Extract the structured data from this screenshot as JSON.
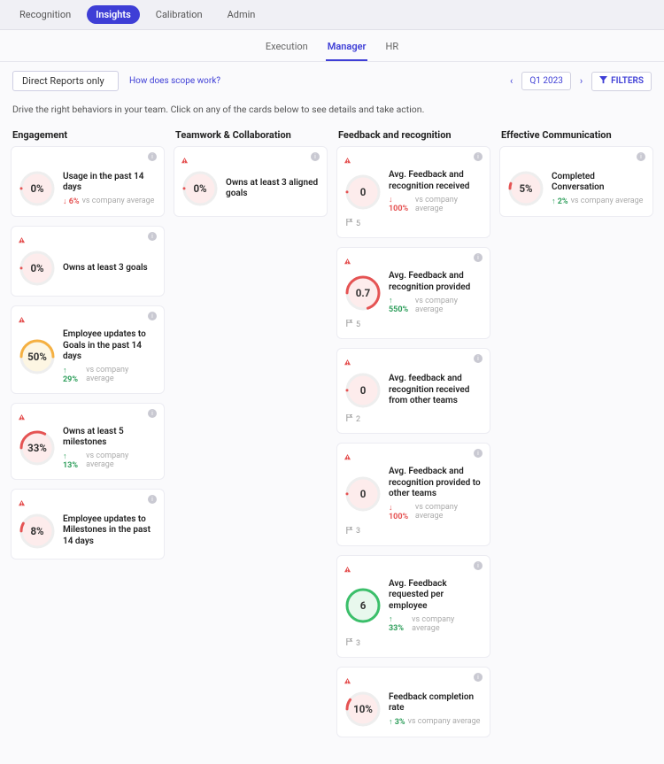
{
  "topnav": {
    "items": [
      {
        "label": "Recognition",
        "active": false
      },
      {
        "label": "Insights",
        "active": true
      },
      {
        "label": "Calibration",
        "active": false
      },
      {
        "label": "Admin",
        "active": false
      }
    ]
  },
  "subtabs": {
    "items": [
      {
        "label": "Execution",
        "active": false
      },
      {
        "label": "Manager",
        "active": true
      },
      {
        "label": "HR",
        "active": false
      }
    ]
  },
  "controls": {
    "scope": "Direct Reports only",
    "scope_help": "How does scope work?",
    "period": "Q1 2023",
    "filters_label": "FILTERS"
  },
  "intro": "Drive the right behaviors in your team. Click on any of the cards below to see details and take action.",
  "columns": [
    {
      "title": "Engagement",
      "cards": [
        {
          "value": "0%",
          "ring_pct": 0,
          "ring_color": "#e55353",
          "style": "pink",
          "title": "Usage in the past 14 days",
          "delta_dir": "down",
          "delta_val": "6%",
          "delta_vs": "vs company average",
          "warn": false
        },
        {
          "value": "0%",
          "ring_pct": 0,
          "ring_color": "#e55353",
          "style": "pink",
          "title": "Owns at least 3 goals",
          "delta_dir": null,
          "delta_val": "",
          "delta_vs": "",
          "warn": true
        },
        {
          "value": "50%",
          "ring_pct": 50,
          "ring_color": "#f5b041",
          "style": "yellow",
          "title": "Employee updates to Goals in the past 14 days",
          "delta_dir": "up",
          "delta_val": "29%",
          "delta_vs": "vs company average",
          "warn": true
        },
        {
          "value": "33%",
          "ring_pct": 33,
          "ring_color": "#e55353",
          "style": "pink",
          "title": "Owns at least 5 milestones",
          "delta_dir": "up",
          "delta_val": "13%",
          "delta_vs": "vs company average",
          "warn": true
        },
        {
          "value": "8%",
          "ring_pct": 8,
          "ring_color": "#e55353",
          "style": "pink",
          "title": "Employee updates to Milestones in the past 14 days",
          "delta_dir": null,
          "delta_val": "",
          "delta_vs": "",
          "warn": true
        }
      ]
    },
    {
      "title": "Teamwork & Collaboration",
      "cards": [
        {
          "value": "0%",
          "ring_pct": 0,
          "ring_color": "#e55353",
          "style": "pink",
          "title": "Owns at least 3 aligned goals",
          "delta_dir": null,
          "delta_val": "",
          "delta_vs": "",
          "warn": true
        }
      ]
    },
    {
      "title": "Feedback and recognition",
      "cards": [
        {
          "value": "0",
          "ring_pct": 0,
          "ring_color": "#e55353",
          "style": "pink",
          "title": "Avg. Feedback and recognition received",
          "delta_dir": "down",
          "delta_val": "100%",
          "delta_vs": "vs company average",
          "warn": true,
          "flag": "5"
        },
        {
          "value": "0.7",
          "ring_pct": 70,
          "ring_color": "#e55353",
          "style": "pink",
          "title": "Avg. Feedback and recognition provided",
          "delta_dir": "up",
          "delta_val": "550%",
          "delta_vs": "vs company average",
          "warn": true,
          "flag": "5"
        },
        {
          "value": "0",
          "ring_pct": 0,
          "ring_color": "#e55353",
          "style": "pink",
          "title": "Avg. feedback and recognition received from other teams",
          "delta_dir": null,
          "delta_val": "",
          "delta_vs": "",
          "warn": true,
          "flag": "2"
        },
        {
          "value": "0",
          "ring_pct": 0,
          "ring_color": "#e55353",
          "style": "pink",
          "title": "Avg. Feedback and recognition provided to other teams",
          "delta_dir": "down",
          "delta_val": "100%",
          "delta_vs": "vs company average",
          "warn": true,
          "flag": "3"
        },
        {
          "value": "6",
          "ring_pct": 100,
          "ring_color": "#3bbf6a",
          "style": "green",
          "title": "Avg. Feedback requested per employee",
          "delta_dir": "up",
          "delta_val": "33%",
          "delta_vs": "vs company average",
          "warn": true,
          "flag": "3"
        },
        {
          "value": "10%",
          "ring_pct": 10,
          "ring_color": "#e55353",
          "style": "pink",
          "title": "Feedback completion rate",
          "delta_dir": "up",
          "delta_val": "3%",
          "delta_vs": "vs company average",
          "warn": true
        }
      ]
    },
    {
      "title": "Effective Communication",
      "cards": [
        {
          "value": "5%",
          "ring_pct": 5,
          "ring_color": "#e55353",
          "style": "pink",
          "title": "Completed Conversation",
          "delta_dir": "up",
          "delta_val": "2%",
          "delta_vs": "vs company average",
          "warn": false
        }
      ]
    }
  ]
}
